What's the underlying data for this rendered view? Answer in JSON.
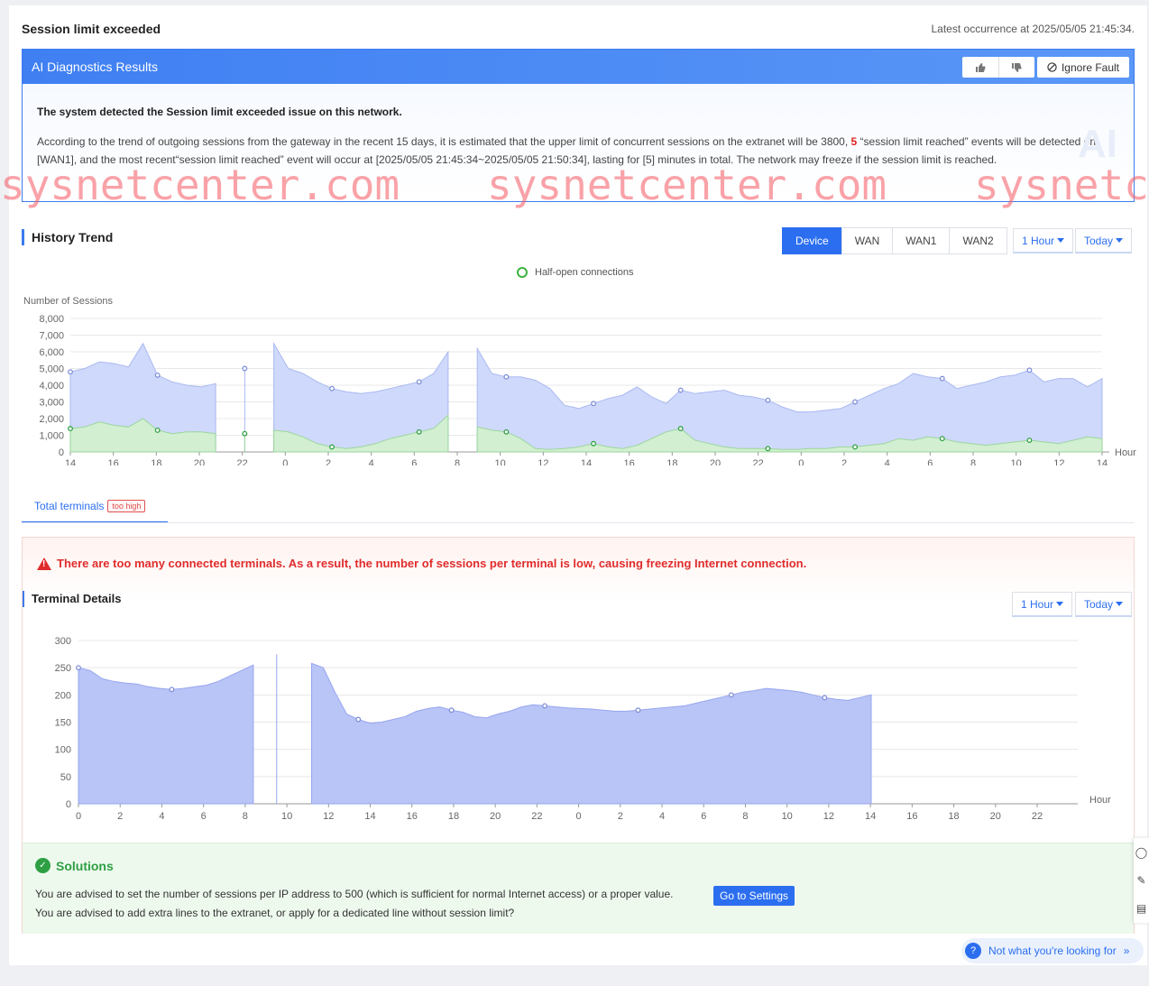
{
  "header": {
    "title": "Session limit exceeded",
    "latest_occurrence": "Latest occurrence at 2025/05/05 21:45:34."
  },
  "ai": {
    "title": "AI Diagnostics Results",
    "ignore_label": "Ignore Fault",
    "headline": "The system detected the Session limit exceeded issue on this network.",
    "text_part1": "According to the trend of outgoing sessions from the gateway in the recent 15 days, it is estimated that the upper limit of concurrent sessions on the extranet will be 3800, ",
    "count": "5",
    "text_part2": " “session limit reached” events will be detected on [WAN1], and the most recent“session limit reached” event will occur at [2025/05/05 21:45:34~2025/05/05 21:50:34], lasting for [5] minutes in total. The network may freeze if the session limit is reached.",
    "watermark": "AI"
  },
  "watermarks": [
    "sysnetcenter.com",
    "sysnetcenter.com",
    "sysnetc"
  ],
  "history": {
    "title": "History Trend",
    "tabs": [
      "Device",
      "WAN",
      "WAN1",
      "WAN2"
    ],
    "active_tab": "Device",
    "interval": "1 Hour",
    "range": "Today",
    "legend": "Half-open connections"
  },
  "terminals": {
    "tab_label": "Total terminals",
    "tab_badge": "too high",
    "alert": "There are too many connected terminals. As a result, the number of sessions per terminal is low, causing freezing Internet connection.",
    "title": "Terminal Details",
    "interval": "1 Hour",
    "range": "Today"
  },
  "solutions": {
    "title": "Solutions",
    "line1": "You are advised to set the number of sessions per IP address to 500 (which is sufficient for normal Internet access) or a proper value.",
    "go_label": "Go to Settings",
    "line2": "You are advised to add extra lines to the extranet, or apply for a dedicated line without session limit?"
  },
  "help": {
    "label": "Not what you're looking for"
  },
  "colors": {
    "accent": "#2b6ef0",
    "sessions_fill": "#c9d5fb",
    "halfopen": "#3db33d",
    "terminals_fill": "#b4c1f8",
    "alert": "#e02c2c"
  },
  "chart_data": [
    {
      "type": "area",
      "title": "",
      "ylabel": "Number of Sessions",
      "xlabel": "Hour",
      "ylim": [
        0,
        8000
      ],
      "yticks": [
        0,
        1000,
        2000,
        3000,
        4000,
        5000,
        6000,
        7000,
        8000
      ],
      "ytick_labels": [
        "0",
        "1,000",
        "2,000",
        "3,000",
        "4,000",
        "5,000",
        "6,000",
        "7,000",
        "8,000"
      ],
      "x_tick_labels": [
        "14",
        "16",
        "18",
        "20",
        "22",
        "0",
        "2",
        "4",
        "6",
        "8",
        "10",
        "12",
        "14",
        "16",
        "18",
        "20",
        "22",
        "0",
        "2",
        "4",
        "6",
        "8",
        "10",
        "12",
        "14"
      ],
      "legend_position": "top-center",
      "series": [
        {
          "name": "",
          "values": [
            4800,
            5000,
            5400,
            5300,
            5100,
            6500,
            4600,
            4200,
            4000,
            3900,
            4100,
            null,
            5000,
            null,
            6500,
            5000,
            4700,
            4200,
            3800,
            3600,
            3500,
            3600,
            3800,
            4000,
            4200,
            4700,
            6000,
            null,
            6200,
            4700,
            4500,
            4500,
            4300,
            3800,
            2800,
            2600,
            2900,
            3200,
            3400,
            3900,
            3300,
            2900,
            3700,
            3500,
            3600,
            3700,
            3400,
            3300,
            3100,
            2700,
            2400,
            2400,
            2500,
            2600,
            3000,
            3400,
            3800,
            4100,
            4700,
            4500,
            4400,
            3800,
            4000,
            4200,
            4500,
            4600,
            4900,
            4200,
            4400,
            4400,
            3900,
            4400
          ]
        },
        {
          "name": "Half-open connections",
          "values": [
            1400,
            1500,
            1800,
            1600,
            1500,
            2000,
            1300,
            1100,
            1200,
            1200,
            1100,
            null,
            1100,
            null,
            1300,
            1200,
            900,
            500,
            300,
            200,
            300,
            500,
            800,
            1000,
            1200,
            1400,
            2200,
            null,
            1500,
            1300,
            1200,
            800,
            200,
            150,
            200,
            300,
            500,
            300,
            200,
            400,
            800,
            1200,
            1400,
            700,
            500,
            300,
            200,
            200,
            200,
            150,
            150,
            200,
            200,
            300,
            300,
            400,
            500,
            800,
            700,
            900,
            800,
            600,
            500,
            400,
            500,
            600,
            700,
            600,
            500,
            700,
            900,
            800
          ]
        }
      ]
    },
    {
      "type": "area",
      "title": "",
      "ylabel": "",
      "xlabel": "Hour",
      "ylim": [
        0,
        300
      ],
      "yticks": [
        0,
        50,
        100,
        150,
        200,
        250,
        300
      ],
      "x_tick_labels": [
        "0",
        "2",
        "4",
        "6",
        "8",
        "10",
        "12",
        "14",
        "16",
        "18",
        "20",
        "22",
        "0",
        "2",
        "4",
        "6",
        "8",
        "10",
        "12",
        "14",
        "16",
        "18",
        "20",
        "22"
      ],
      "series": [
        {
          "name": "",
          "values": [
            250,
            245,
            230,
            225,
            222,
            220,
            215,
            212,
            210,
            212,
            215,
            218,
            225,
            235,
            245,
            255,
            null,
            275,
            null,
            null,
            258,
            250,
            205,
            165,
            155,
            148,
            150,
            155,
            160,
            170,
            175,
            178,
            172,
            168,
            160,
            158,
            165,
            170,
            178,
            182,
            180,
            178,
            176,
            175,
            174,
            172,
            170,
            170,
            172,
            174,
            176,
            178,
            180,
            185,
            190,
            195,
            200,
            205,
            208,
            212,
            210,
            208,
            205,
            200,
            195,
            192,
            190,
            195,
            200
          ]
        }
      ]
    }
  ]
}
